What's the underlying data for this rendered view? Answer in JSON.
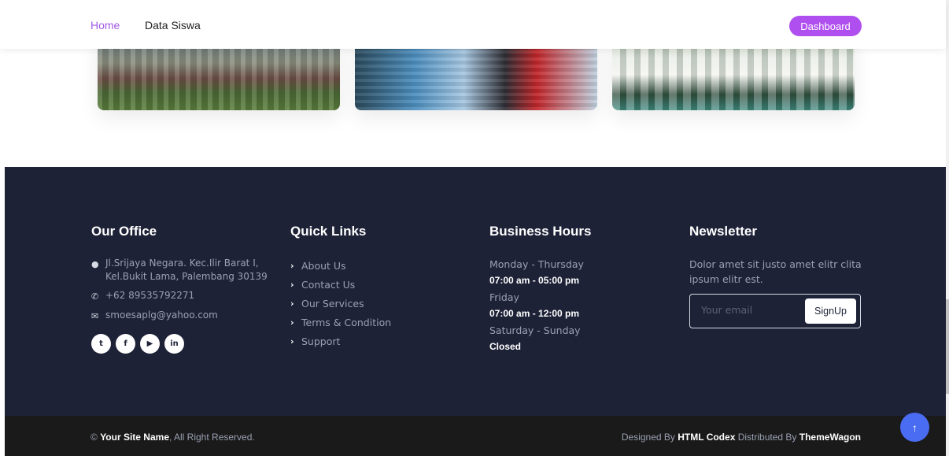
{
  "nav": {
    "home": "Home",
    "data_siswa": "Data Siswa",
    "dashboard": "Dashboard"
  },
  "colors": {
    "accent": "#b04ff0",
    "footer_bg": "#1e2237",
    "bottom_bg": "#1a1a1a",
    "back_to_top": "#4a6cf2"
  },
  "footer": {
    "office": {
      "title": "Our Office",
      "address": "Jl.Srijaya Negara. Kec.Ilir Barat I, Kel.Bukit Lama, Palembang 30139",
      "phone": "+62 89535792271",
      "email": "smoesaplg@yahoo.com",
      "social": [
        {
          "icon": "twitter-icon",
          "glyph": "t"
        },
        {
          "icon": "facebook-icon",
          "glyph": "f"
        },
        {
          "icon": "youtube-icon",
          "glyph": "▶"
        },
        {
          "icon": "linkedin-icon",
          "glyph": "in"
        }
      ]
    },
    "quick_links": {
      "title": "Quick Links",
      "items": [
        "About Us",
        "Contact Us",
        "Our Services",
        "Terms & Condition",
        "Support"
      ]
    },
    "hours": {
      "title": "Business Hours",
      "rows": [
        {
          "day": "Monday - Thursday",
          "time": "07:00 am - 05:00 pm"
        },
        {
          "day": "Friday",
          "time": "07:00 am - 12:00 pm"
        },
        {
          "day": "Saturday - Sunday",
          "time": "Closed"
        }
      ]
    },
    "newsletter": {
      "title": "Newsletter",
      "text": "Dolor amet sit justo amet elitr clita ipsum elitr est.",
      "placeholder": "Your email",
      "button": "SignUp"
    }
  },
  "bottom": {
    "copyright_symbol": "©",
    "site_name": "Your Site Name",
    "rights": ", All Right Reserved.",
    "designed_by": "Designed By",
    "designer": "HTML Codex",
    "distributed_by": "Distributed By",
    "distributor": "ThemeWagon"
  }
}
